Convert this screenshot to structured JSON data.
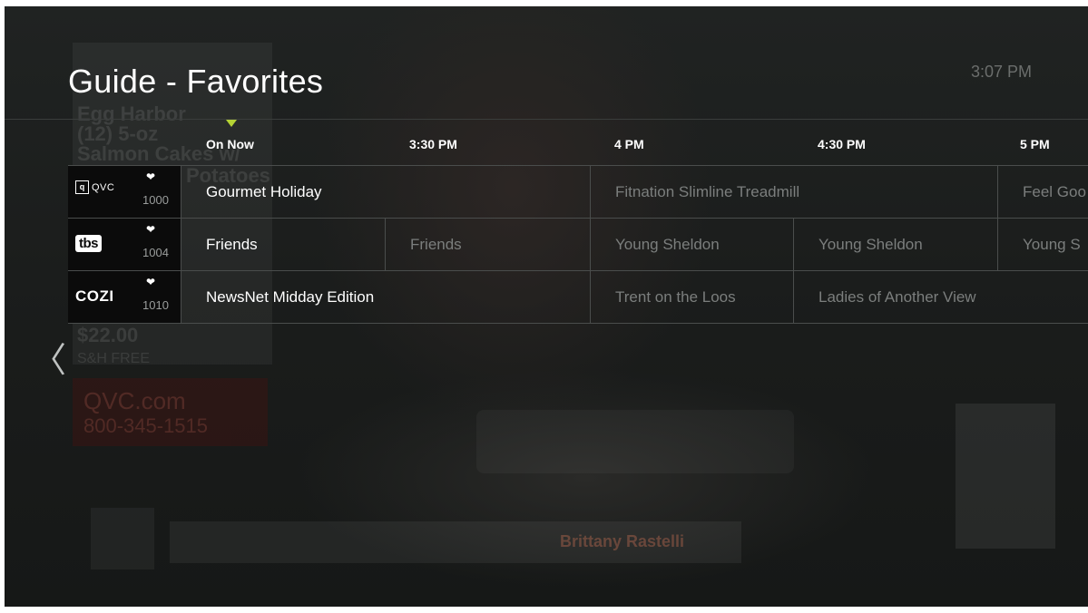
{
  "header": {
    "title": "Guide - Favorites",
    "clock": "3:07 PM"
  },
  "timeline": {
    "slots": [
      "On Now",
      "3:30 PM",
      "4 PM",
      "4:30 PM",
      "5 PM"
    ],
    "now_marker_color": "#b5d334"
  },
  "channels": [
    {
      "logo": "QVC",
      "logo_icon": "qvc-logo",
      "favorite_icon": "heart-icon",
      "favorite_glyph": "❤",
      "number": "1000",
      "programs": [
        "Gourmet Holiday",
        "Fitnation Slimline Treadmill",
        "Feel Goo"
      ]
    },
    {
      "logo": "tbs",
      "logo_icon": "tbs-logo",
      "favorite_icon": "heart-icon",
      "favorite_glyph": "❤",
      "number": "1004",
      "programs": [
        "Friends",
        "Friends",
        "Young Sheldon",
        "Young Sheldon",
        "Young S"
      ]
    },
    {
      "logo": "COZI",
      "logo_icon": "cozi-logo",
      "favorite_icon": "heart-icon",
      "favorite_glyph": "❤",
      "number": "1010",
      "programs": [
        "NewsNet Midday Edition",
        "Trent on the Loos",
        "Ladies of Another View"
      ]
    }
  ],
  "nav": {
    "back_arrow_icon": "chevron-left-icon",
    "back_arrow_glyph": "〈"
  },
  "background_video": {
    "overlay_lines": [
      "Egg Harbor",
      "(12) 5-oz",
      "Salmon Cakes w/",
      "Potatoes",
      "$22.00",
      "S&H FREE"
    ],
    "promo_lines": [
      "QVC.com",
      "800-345-1515"
    ],
    "host_name": "Brittany Rastelli"
  }
}
